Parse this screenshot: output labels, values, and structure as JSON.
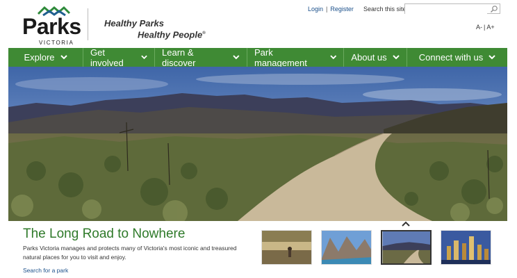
{
  "brand": {
    "name": "Parks",
    "sub": "VICTORIA",
    "tagline_line1": "Healthy Parks",
    "tagline_line2": "Healthy People",
    "tagline_mark": "®",
    "colors": {
      "green": "#3f8a34",
      "title_green": "#2f7a2a",
      "logo_blue": "#1f5f8f",
      "logo_green": "#2e8a3a"
    }
  },
  "utility": {
    "login": "Login",
    "separator": "|",
    "register": "Register",
    "search_label": "Search this site",
    "search_placeholder": ""
  },
  "text_size": {
    "smaller": "A-",
    "sep": "|",
    "larger": "A+"
  },
  "nav": [
    {
      "label": "Explore"
    },
    {
      "label": "Get involved"
    },
    {
      "label": "Learn & discover"
    },
    {
      "label": "Park management"
    },
    {
      "label": "About us"
    },
    {
      "label": "Connect with us"
    }
  ],
  "feature": {
    "title": "The Long Road to Nowhere",
    "description": "Parks Victoria manages and protects many of Victoria's most iconic and treasured natural places for you to visit and enjoy.",
    "link": "Search for a park"
  },
  "thumbnails": [
    {
      "name": "river-wader",
      "active": false
    },
    {
      "name": "mountain-lake",
      "active": false
    },
    {
      "name": "outback-road",
      "active": true
    },
    {
      "name": "city-skyline",
      "active": false
    }
  ]
}
